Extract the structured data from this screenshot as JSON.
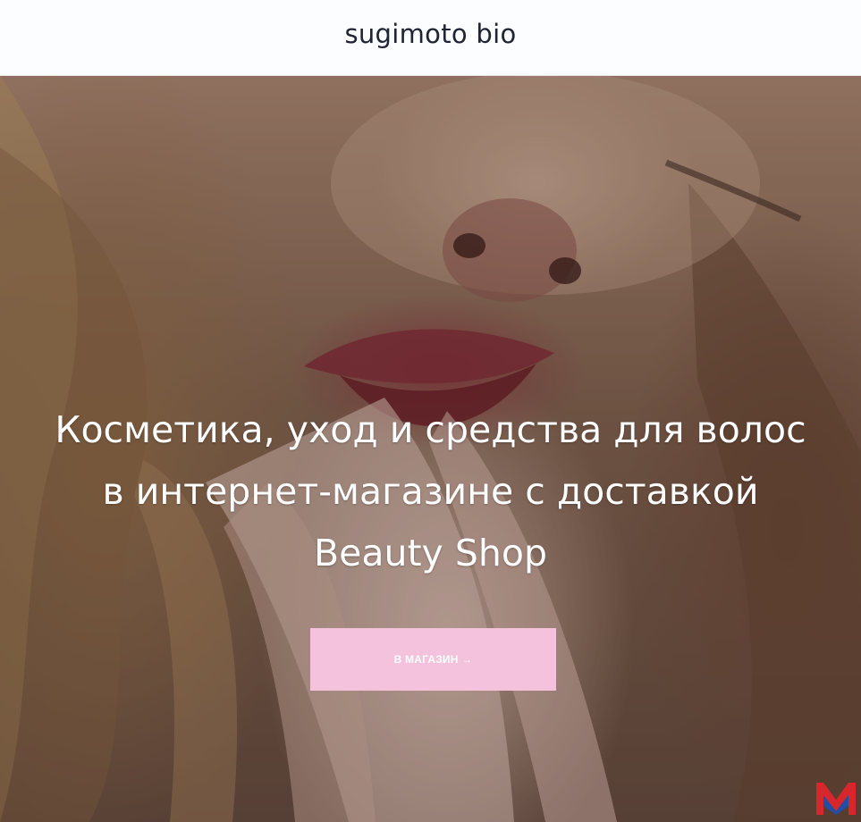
{
  "header": {
    "site_title": "sugimoto bio"
  },
  "hero": {
    "headline": "Косметика, уход и средства для волос в интернет-магазине с доставкой Beauty Shop",
    "cta_label": "В МАГАЗИН →"
  },
  "colors": {
    "header_background": "#fbfdfe",
    "title_text": "#1f2333",
    "headline_text": "#ffffff",
    "cta_background": "#f5c2dd",
    "cta_text": "#ffffff",
    "watermark_red": "#d8262d",
    "watermark_blue": "#1f4fa8"
  },
  "icons": {
    "watermark": "m-logo-icon"
  }
}
